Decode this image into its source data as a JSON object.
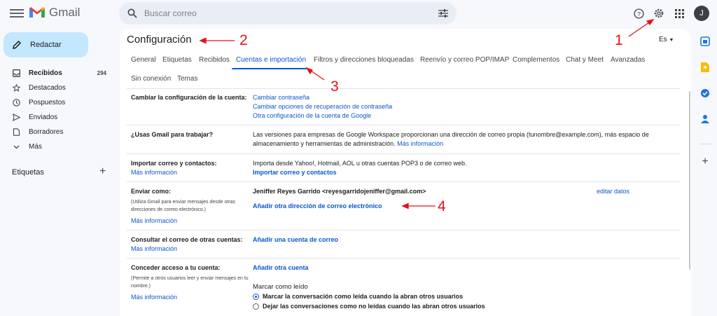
{
  "app": {
    "name": "Gmail",
    "avatar_initial": "J"
  },
  "search": {
    "placeholder": "Buscar correo"
  },
  "topbar_icons": [
    "menu-icon",
    "search-icon",
    "filter-options-icon",
    "help-icon",
    "gear-icon",
    "apps-icon"
  ],
  "compose": {
    "label": "Redactar"
  },
  "nav": [
    {
      "label": "Recibidos",
      "count": "294",
      "icon": "inbox-icon",
      "bold": true
    },
    {
      "label": "Destacados",
      "count": "",
      "icon": "star-icon"
    },
    {
      "label": "Pospuestos",
      "count": "",
      "icon": "clock-icon"
    },
    {
      "label": "Enviados",
      "count": "",
      "icon": "send-icon"
    },
    {
      "label": "Borradores",
      "count": "",
      "icon": "draft-icon"
    },
    {
      "label": "Más",
      "count": "",
      "icon": "chevron-down-icon"
    }
  ],
  "labels": {
    "title": "Etiquetas"
  },
  "settings": {
    "title": "Configuración",
    "lang": "Es",
    "tabs": [
      "General",
      "Etiquetas",
      "Recibidos",
      "Cuentas e importación",
      "Filtros y direcciones bloqueadas",
      "Reenvío y correo POP/IMAP",
      "Complementos",
      "Chat y Meet",
      "Avanzadas"
    ],
    "tabs_row2": [
      "Sin conexión",
      "Temas"
    ],
    "active_tab": "Cuentas e importación",
    "sections": {
      "change_account": {
        "label": "Cambiar la configuración de la cuenta:",
        "links": [
          "Cambiar contraseña",
          "Cambiar opciones de recuperación de contraseña",
          "Otra configuración de la cuenta de Google"
        ]
      },
      "workspace": {
        "label": "¿Usas Gmail para trabajar?",
        "text": "Las versiones para empresas de Google Workspace proporcionan una dirección de correo propia (tunombre@example.com), más espacio de almacenamiento y herramientas de administración.",
        "link": "Más información"
      },
      "import": {
        "label": "Importar correo y contactos:",
        "more": "Más información",
        "text": "Importa desde Yahoo!, Hotmail, AOL u otras cuentas POP3 o de correo web.",
        "action": "Importar correo y contactos"
      },
      "send_as": {
        "label": "Enviar como:",
        "note": "(Utiliza Gmail para enviar mensajes desde otras direcciones de correo electrónico.)",
        "more": "Más información",
        "identity": "Jeniffer Reyes Garrido <reyesgarridojeniffer@gmail.com>",
        "edit": "editar datos",
        "add": "Añadir otra dirección de correo electrónico"
      },
      "check_mail": {
        "label": "Consultar el correo de otras cuentas:",
        "more": "Más información",
        "add": "Añadir una cuenta de correo"
      },
      "grant_access": {
        "label": "Conceder acceso a tu cuenta:",
        "note": "(Permite a otros usuarios leer y enviar mensajes en tu nombre.)",
        "more": "Más información",
        "add": "Añadir otra cuenta",
        "mark_read_title": "Marcar como leído",
        "options": [
          "Marcar la conversación como leída cuando la abran otros usuarios",
          "Dejar las conversaciones como no leídas cuando las abran otros usuarios"
        ],
        "selected_option": 0
      }
    }
  },
  "annotations": [
    "1",
    "2",
    "3",
    "4"
  ],
  "colors": {
    "accent": "#0b57d0",
    "annotation": "#e3131c",
    "compose_bg": "#c2e7ff",
    "page_bg": "#f6f8fc"
  }
}
